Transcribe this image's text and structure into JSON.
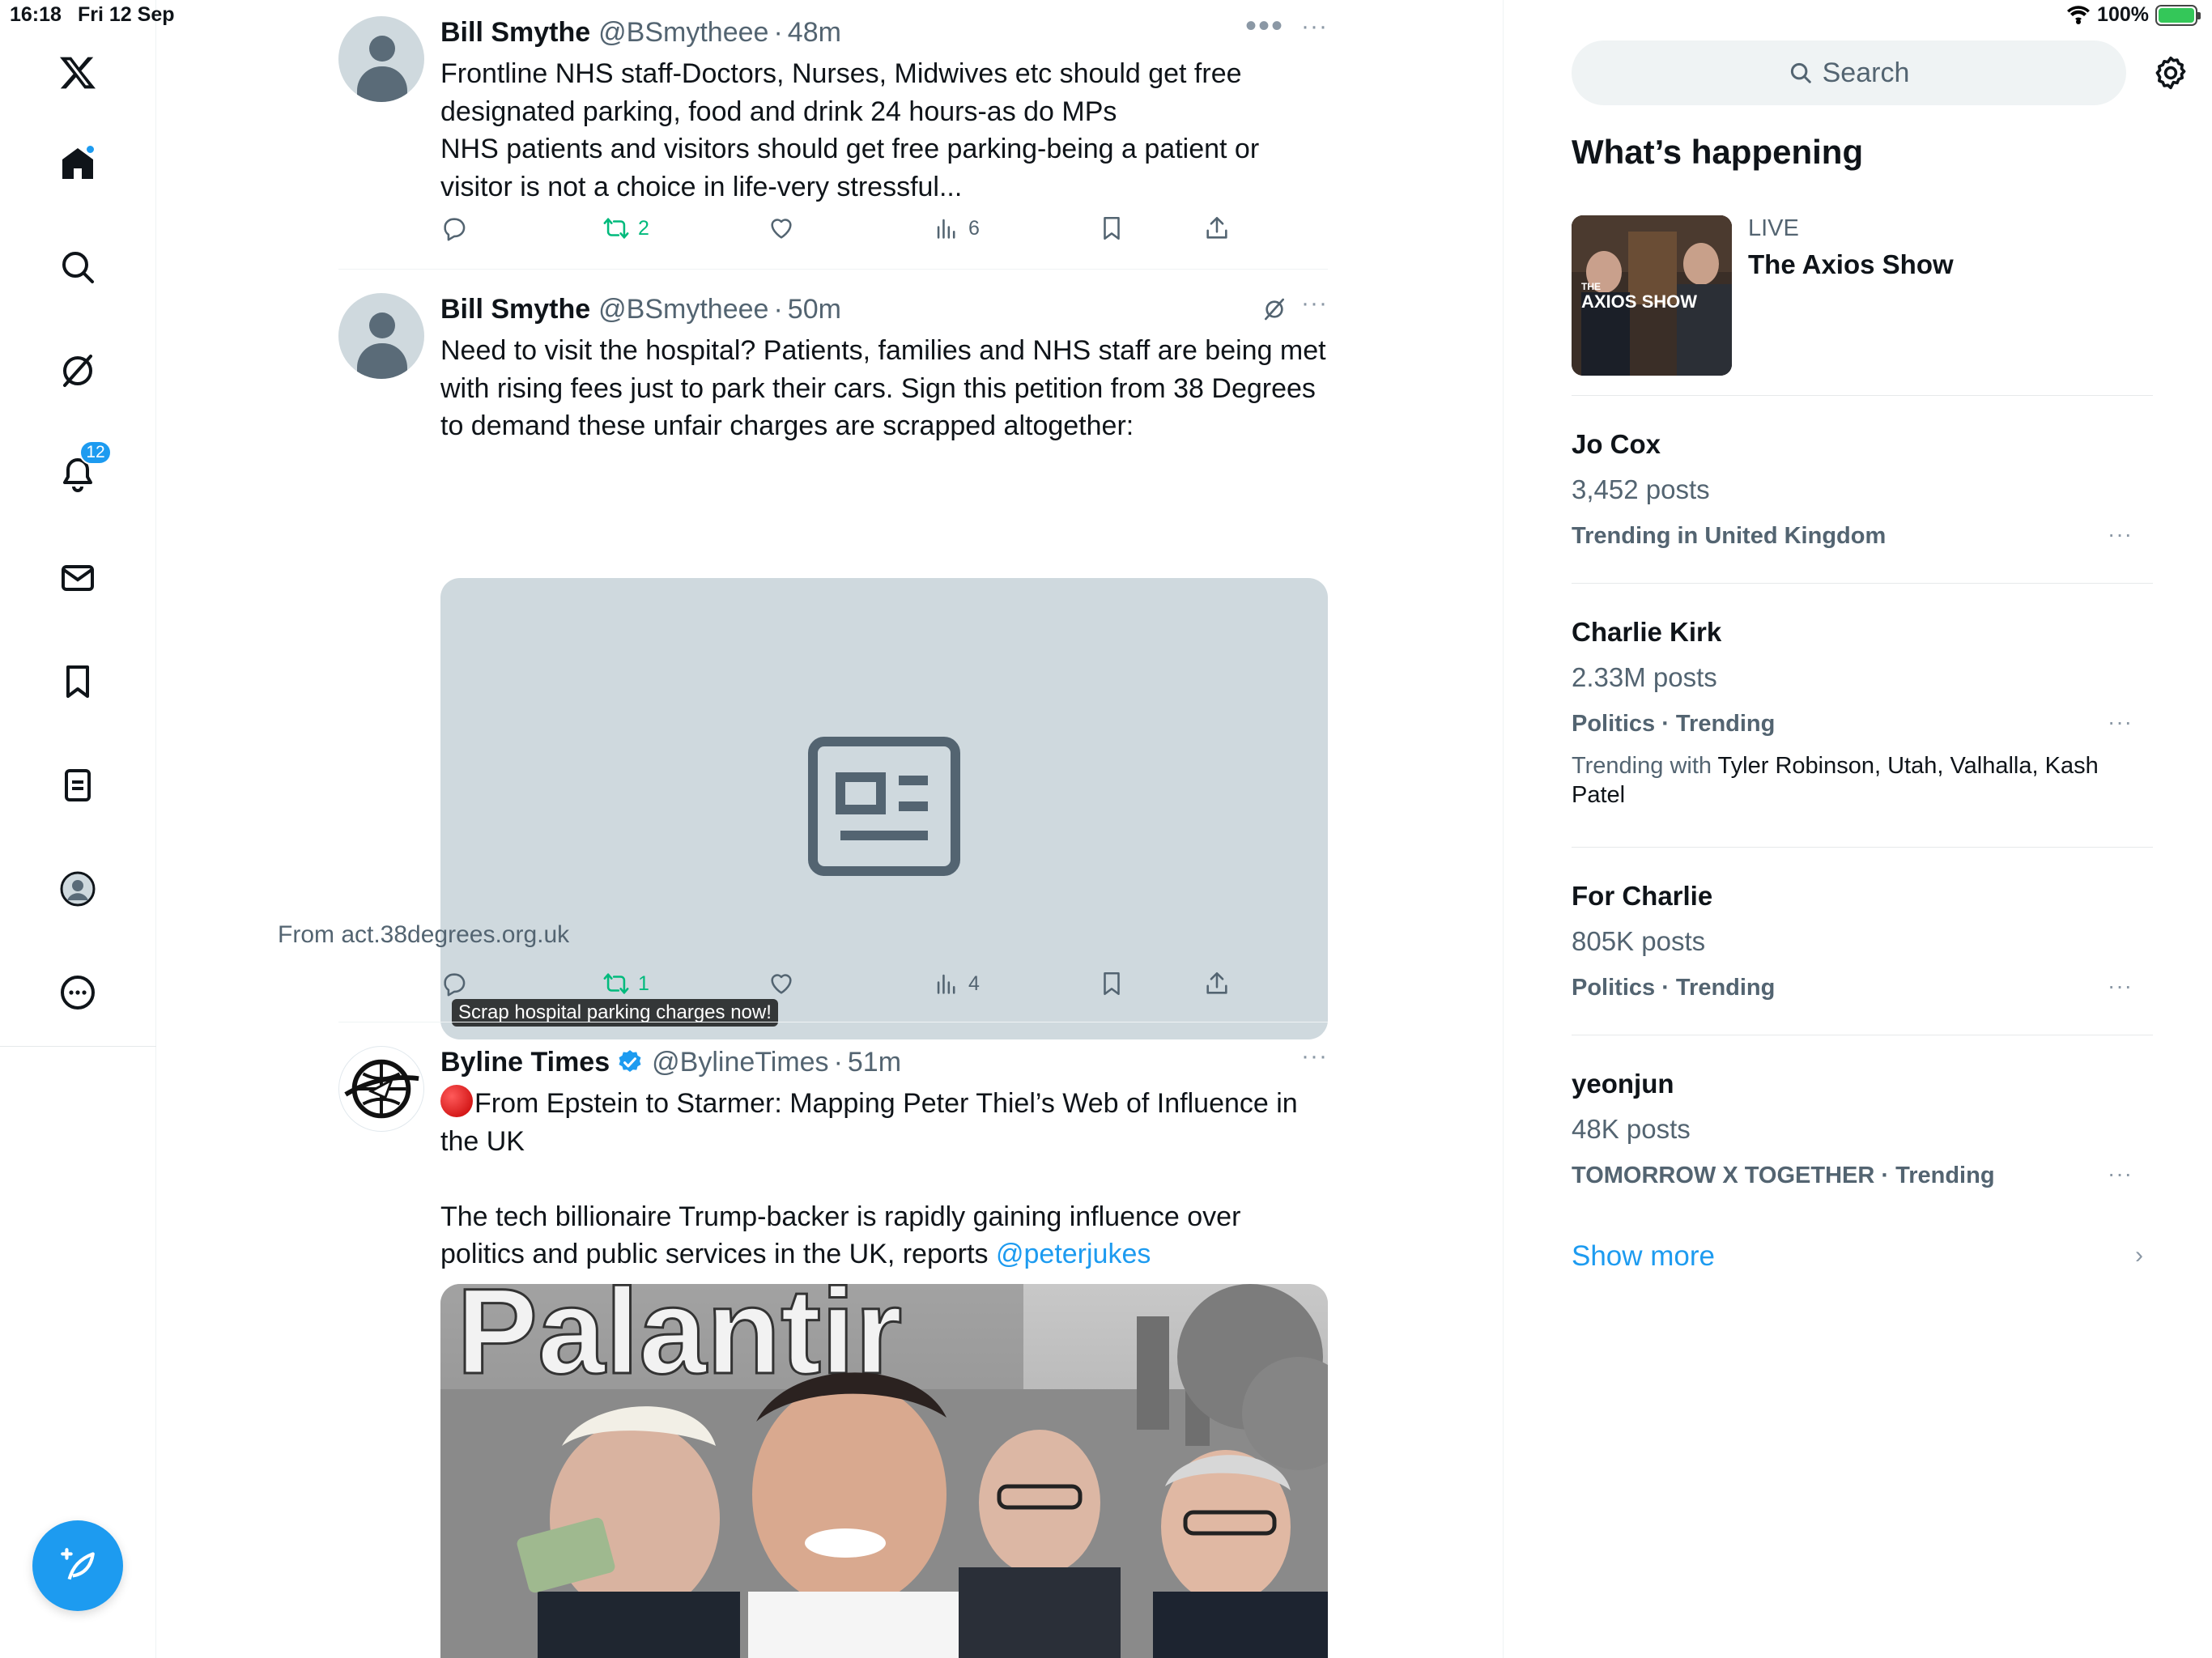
{
  "status_bar": {
    "time": "16:18",
    "date": "Fri 12 Sep",
    "battery": "100%"
  },
  "nav": {
    "notifications_badge": "12"
  },
  "tweets": [
    {
      "name": "Bill Smythe",
      "handle": "@BSmytheee",
      "sep": "·",
      "time": "48m",
      "more": "···",
      "text": "Frontline NHS staff-Doctors, Nurses, Midwives etc should get free designated parking, food and drink 24 hours-as do MPs\nNHS patients and visitors should get free parking-being a patient or visitor is not a choice in life-very stressful...",
      "retweets": "2",
      "views": "6"
    },
    {
      "name": "Bill Smythe",
      "handle": "@BSmytheee",
      "sep": "·",
      "time": "50m",
      "more": "···",
      "text": "Need to visit the hospital? Patients, families and NHS staff are being met with rising fees just to park their cars. Sign this petition from 38 Degrees to demand these unfair charges are scrapped altogether:",
      "card_label": "Scrap hospital parking charges now!",
      "card_source": "From act.38degrees.org.uk",
      "retweets": "1",
      "views": "4"
    },
    {
      "name": "Byline Times",
      "handle": "@BylineTimes",
      "sep": "·",
      "time": "51m",
      "more": "···",
      "text_line1": "From Epstein to Starmer: Mapping Peter Thiel’s Web of Influence in the UK",
      "text_line2": "The tech billionaire Trump-backer is rapidly gaining influence over politics and public services in the UK, reports ",
      "mention": "@peterjukes",
      "media_text": "Palantir"
    }
  ],
  "sidebar": {
    "search_placeholder": "Search",
    "whats_happening": "What’s happening",
    "live": {
      "label": "LIVE",
      "title": "The Axios Show",
      "thumb_text": "AXIOS SHOW",
      "thumb_small": "THE"
    },
    "trends": [
      {
        "name": "Jo Cox",
        "count": "3,452 posts",
        "context": "Trending in United Kingdom",
        "more": "···"
      },
      {
        "name": "Charlie Kirk",
        "count": "2.33M posts",
        "context": "Politics · Trending",
        "with_label": "Trending with ",
        "with": "Tyler Robinson, Utah, Valhalla, Kash Patel",
        "more": "···"
      },
      {
        "name": "For Charlie",
        "count": "805K posts",
        "context": "Politics · Trending",
        "more": "···"
      },
      {
        "name": "yeonjun",
        "count": "48K posts",
        "context": "TOMORROW X TOGETHER · Trending",
        "more": "···"
      }
    ],
    "show_more": "Show more",
    "show_more_chevron": "›"
  },
  "colors": {
    "accent": "#1d9bf0",
    "retweet": "#00ba7c",
    "muted": "#536471"
  }
}
